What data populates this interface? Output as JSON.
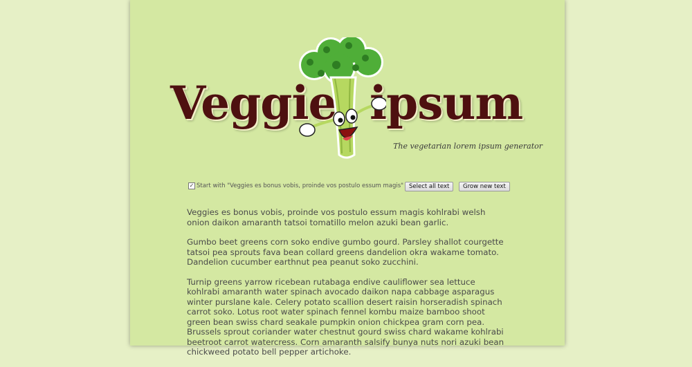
{
  "logo": {
    "word_left": "Veggie",
    "word_right": "ipsum",
    "tagline": "The vegetarian lorem ipsum generator"
  },
  "controls": {
    "start_with_checked": true,
    "start_with_label": "Start with \"Veggies es bonus vobis, proinde vos postulo essum magis\"",
    "select_all_label": "Select all text",
    "grow_label": "Grow new text"
  },
  "content": {
    "paragraphs": [
      "Veggies es bonus vobis, proinde vos postulo essum magis kohlrabi welsh onion daikon amaranth tatsoi tomatillo melon azuki bean garlic.",
      "Gumbo beet greens corn soko endive gumbo gourd. Parsley shallot courgette tatsoi pea sprouts fava bean collard greens dandelion okra wakame tomato. Dandelion cucumber earthnut pea peanut soko zucchini.",
      "Turnip greens yarrow ricebean rutabaga endive cauliflower sea lettuce kohlrabi amaranth water spinach avocado daikon napa cabbage asparagus winter purslane kale. Celery potato scallion desert raisin horseradish spinach carrot soko. Lotus root water spinach fennel kombu maize bamboo shoot green bean swiss chard seakale pumpkin onion chickpea gram corn pea. Brussels sprout coriander water chestnut gourd swiss chard wakame kohlrabi beetroot carrot watercress. Corn amaranth salsify bunya nuts nori azuki bean chickweed potato bell pepper artichoke."
    ]
  },
  "colors": {
    "page_background": "#e6f0c6",
    "content_background": "#d4e8a2",
    "logo_text": "#4e1010"
  },
  "icons": {
    "mascot": "broccoli-mascot-icon"
  }
}
